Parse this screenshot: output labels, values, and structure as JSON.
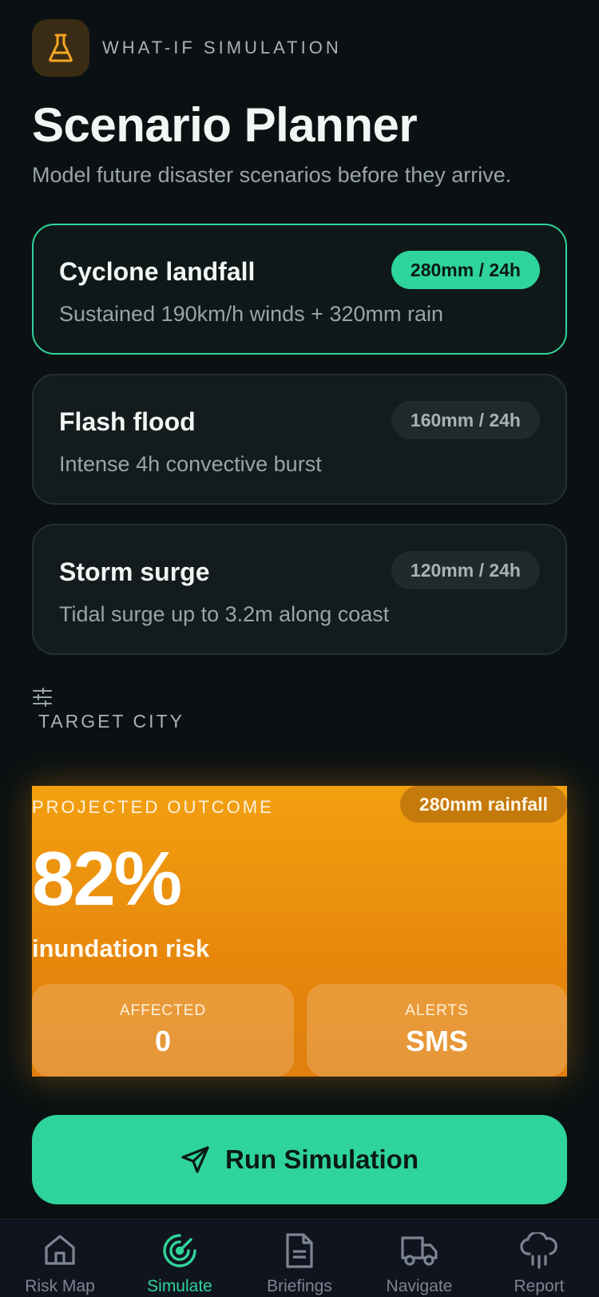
{
  "header": {
    "eyebrow": "WHAT-IF SIMULATION",
    "title": "Scenario Planner",
    "subtitle": "Model future disaster scenarios before they arrive."
  },
  "scenarios": [
    {
      "name": "Cyclone landfall",
      "rainfall": "280mm / 24h",
      "description": "Sustained 190km/h winds + 320mm rain",
      "selected": true
    },
    {
      "name": "Flash flood",
      "rainfall": "160mm / 24h",
      "description": "Intense 4h convective burst",
      "selected": false
    },
    {
      "name": "Storm surge",
      "rainfall": "120mm / 24h",
      "description": "Tidal surge up to 3.2m along coast",
      "selected": false
    }
  ],
  "target_city": {
    "label": "TARGET CITY",
    "icon": "sliders-icon"
  },
  "outcome": {
    "label": "PROJECTED OUTCOME",
    "rainfall_badge": "280mm rainfall",
    "risk_value": "82%",
    "risk_caption": "inundation risk",
    "stats": [
      {
        "key": "AFFECTED",
        "value": "0"
      },
      {
        "key": "ALERTS",
        "value": "SMS"
      }
    ]
  },
  "run_button": {
    "label": "Run Simulation",
    "icon": "send-icon"
  },
  "nav": {
    "items": [
      {
        "label": "Risk Map",
        "icon": "home-icon",
        "active": false
      },
      {
        "label": "Simulate",
        "icon": "radar-icon",
        "active": true
      },
      {
        "label": "Briefings",
        "icon": "document-icon",
        "active": false
      },
      {
        "label": "Navigate",
        "icon": "truck-icon",
        "active": false
      },
      {
        "label": "Report",
        "icon": "rain-cloud-icon",
        "active": false
      }
    ]
  },
  "colors": {
    "background": "#0b1112",
    "accent": "#2fd49a",
    "outcome": "#f3a010",
    "flask": "#f5a524"
  }
}
